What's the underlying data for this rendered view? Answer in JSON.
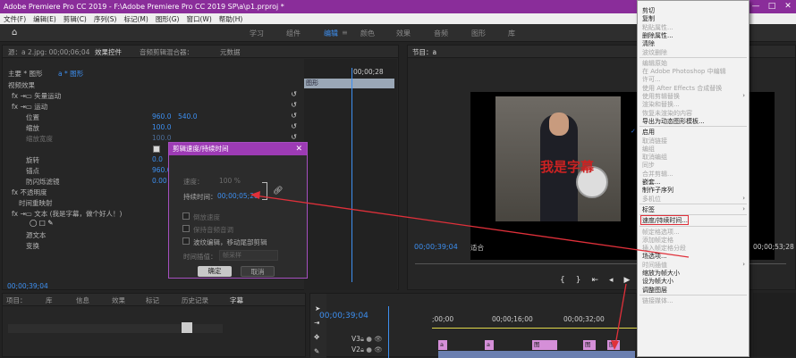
{
  "window": {
    "title": "Adobe Premiere Pro CC 2019 - F:\\Adobe Premiere Pro CC 2019 SP\\a\\p1.prproj *",
    "controls": [
      "—",
      "□",
      "✕"
    ]
  },
  "menubar": [
    "文件(F)",
    "编辑(E)",
    "剪辑(C)",
    "序列(S)",
    "标记(M)",
    "图形(G)",
    "窗口(W)",
    "帮助(H)"
  ],
  "workspaces": [
    "学习",
    "组件",
    "编辑",
    "颜色",
    "效果",
    "音频",
    "图形",
    "库"
  ],
  "source_header": "源：a 2.jpg: 00;00;06;04",
  "panel_tabs": [
    "效果控件",
    "音频剪辑混合器：",
    "元数据"
  ],
  "effect_controls": {
    "clip_path": "主要 * 图形",
    "clip_name": "a * 图形",
    "section": "视频效果",
    "rows": [
      "fx  ⇥▭ 矢量运动",
      "fx  ⇥▭ 运动",
      "位置",
      "缩放",
      "缩放宽度",
      "",
      "旋转",
      "锚点",
      "防闪烁滤镜",
      "fx  不透明度",
      "时间重映射",
      "fx  ⇥▭ 文本 (我是字幕，做个好人！)",
      "",
      "源文本",
      "变换"
    ],
    "values": {
      "pos_x": "960.0",
      "pos_y": "540.0",
      "scale": "100.0",
      "scale_w": "100.0",
      "rot": "0.0",
      "anchor": "960.0",
      "flicker": "0.00"
    },
    "mini_timecode": "00;00;28",
    "mini_clip": "图形",
    "timecode": "00;00;39;04"
  },
  "dialog": {
    "title": "剪辑速度/持续时间",
    "speed_label": "速度：",
    "speed_value": "100 %",
    "duration_label": "持续时间：",
    "duration_value": "00;00;05;28",
    "reverse": "倒放速度",
    "keep_pitch": "保持音频音调",
    "ripple": "波纹编辑，移动尾部剪辑",
    "interp_label": "时间插值：",
    "interp_value": "帧采样",
    "ok": "确定",
    "cancel": "取消"
  },
  "program": {
    "title": "节目：a",
    "timecode": "00;00;39;04",
    "fit": "适合",
    "end_timecode": "00;00;53;28",
    "slide_text": "我是字幕"
  },
  "bottom_tabs": [
    "项目：",
    "库",
    "信息",
    "效果",
    "标记",
    "历史记录",
    "字幕"
  ],
  "timeline": {
    "timecode": "00;00;39;04",
    "ruler": [
      ";00;00",
      "00;00;16;00",
      "00;00;32;00"
    ],
    "tracks": [
      "V3",
      "V2"
    ],
    "clips": [
      "a",
      "a",
      "图",
      "图",
      "图"
    ]
  },
  "context_menu": [
    {
      "label": "剪切",
      "dis": false
    },
    {
      "label": "复制",
      "dis": false
    },
    {
      "label": "粘贴属性...",
      "dis": true
    },
    {
      "label": "删除属性...",
      "dis": false
    },
    {
      "label": "清除",
      "dis": false
    },
    {
      "label": "波纹删除",
      "dis": true
    },
    {
      "sep": true
    },
    {
      "label": "编辑原始",
      "dis": true
    },
    {
      "label": "在 Adobe Photoshop 中编辑",
      "dis": true
    },
    {
      "label": "许可...",
      "dis": true
    },
    {
      "label": "使用 After Effects 合成替换",
      "dis": true
    },
    {
      "label": "使用剪辑替换",
      "dis": true,
      "sub": true
    },
    {
      "label": "渲染和替换...",
      "dis": true
    },
    {
      "label": "恢复未渲染的内容",
      "dis": true
    },
    {
      "label": "导出为动态图形模板...",
      "dis": false
    },
    {
      "sep": true
    },
    {
      "label": "启用",
      "dis": false,
      "check": true
    },
    {
      "label": "取消链接",
      "dis": true
    },
    {
      "label": "编组",
      "dis": true
    },
    {
      "label": "取消编组",
      "dis": true
    },
    {
      "label": "同步",
      "dis": true
    },
    {
      "label": "合并剪辑...",
      "dis": true
    },
    {
      "label": "嵌套...",
      "dis": false
    },
    {
      "label": "制作子序列",
      "dis": false
    },
    {
      "label": "多机位",
      "dis": true,
      "sub": true
    },
    {
      "sep": true
    },
    {
      "label": "标签",
      "dis": false,
      "sub": true
    },
    {
      "sep": true
    },
    {
      "label": "速度/持续时间...",
      "dis": false,
      "hl": true
    },
    {
      "sep": true
    },
    {
      "label": "帧定格选项...",
      "dis": true
    },
    {
      "label": "添加帧定格",
      "dis": true
    },
    {
      "label": "插入帧定格分段",
      "dis": true
    },
    {
      "label": "场选项...",
      "dis": false
    },
    {
      "label": "时间插值",
      "dis": true,
      "sub": true
    },
    {
      "label": "缩放为帧大小",
      "dis": false
    },
    {
      "label": "设为帧大小",
      "dis": false
    },
    {
      "label": "调整图层",
      "dis": false
    },
    {
      "sep": true
    },
    {
      "label": "链接媒体...",
      "dis": true
    }
  ],
  "colors": {
    "accent": "#3d8ff0",
    "titlebar": "#8a2d9a",
    "dialog_title": "#9d3bb5",
    "arrow": "#e0303a",
    "clip_pink": "#d58fd8"
  }
}
